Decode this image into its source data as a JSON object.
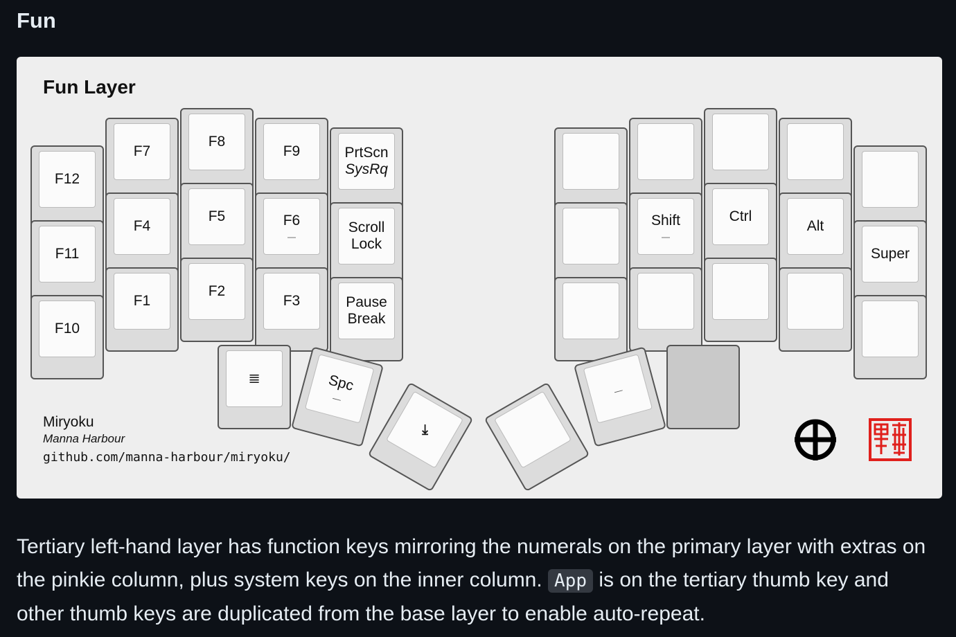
{
  "heading": "Fun",
  "diagram": {
    "title": "Fun Layer",
    "left_hand": {
      "pinkie": [
        "F12",
        "F11",
        "F10"
      ],
      "ring": [
        "F7",
        "F4",
        "F1"
      ],
      "middle": [
        "F8",
        "F5",
        "F2"
      ],
      "index": [
        "F9",
        "F6",
        "F3"
      ],
      "inner": [
        {
          "line1": "PrtScn",
          "line2": "SysRq"
        },
        {
          "line1": "Scroll",
          "line2": "Lock"
        },
        {
          "line1": "Pause",
          "line2": "Break"
        }
      ],
      "f6_hold_mark": "—",
      "thumbs": [
        "≣",
        "Spc",
        "⇥"
      ],
      "spc_hold_mark": "—"
    },
    "right_hand": {
      "home_row": [
        "Shift",
        "Ctrl",
        "Alt",
        "Super"
      ],
      "shift_hold_mark": "—",
      "thumb_hold_mark": "—"
    },
    "credit": {
      "name": "Miryoku",
      "author": "Manna Harbour",
      "url": "github.com/manna-harbour/miryoku/"
    },
    "colors": {
      "seal": "#e0201c",
      "key_outline": "#555555",
      "held_thumb": "#c9c9c9"
    },
    "icons": [
      "circle-cross-logo",
      "seal-stamp"
    ]
  },
  "description": {
    "part1": "Tertiary left-hand layer has function keys mirroring the numerals on the primary layer with extras on the pinkie column, plus system keys on the inner column. ",
    "code": "App",
    "part2": " is on the tertiary thumb key and other thumb keys are duplicated from the base layer to enable auto-repeat."
  }
}
